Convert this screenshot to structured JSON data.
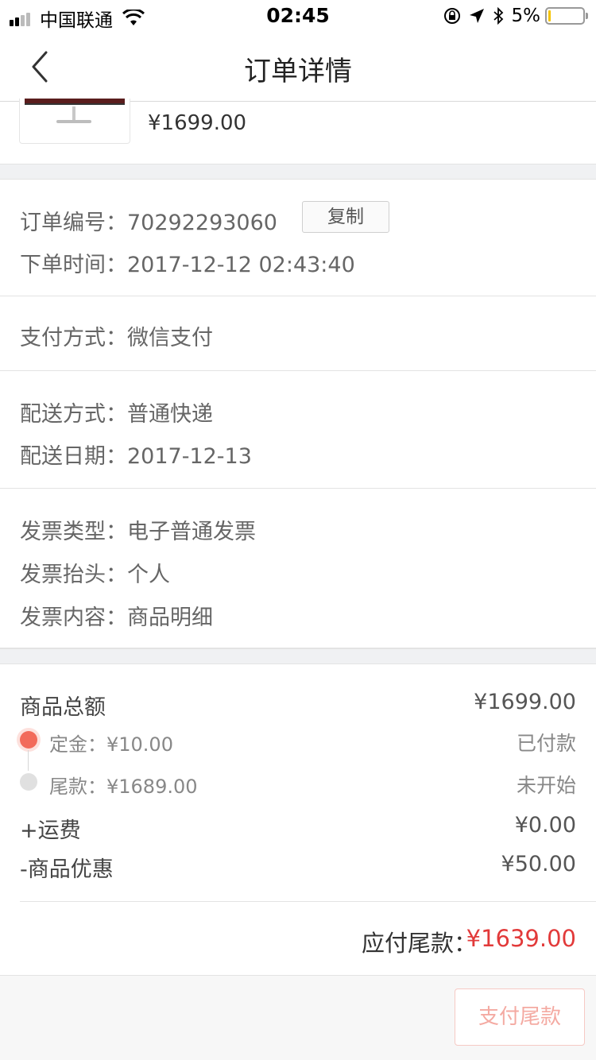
{
  "status_bar": {
    "carrier": "中国联通",
    "time": "02:45",
    "battery": "5%",
    "battery_level": 0.05
  },
  "nav": {
    "title": "订单详情",
    "back_icon": "chevron-left-icon"
  },
  "product": {
    "price": "¥1699.00",
    "thumbnail_icon": "monitor-icon"
  },
  "order_info": {
    "number_label": "订单编号：",
    "number_value": "70292293060",
    "copy_label": "复制",
    "time_label": "下单时间：",
    "time_value": "2017-12-12 02:43:40"
  },
  "payment": {
    "method_label": "支付方式：",
    "method_value": "微信支付"
  },
  "delivery": {
    "method_label": "配送方式：",
    "method_value": "普通快递",
    "date_label": "配送日期：",
    "date_value": "2017-12-13"
  },
  "invoice": {
    "type_label": "发票类型：",
    "type_value": "电子普通发票",
    "title_label": "发票抬头：",
    "title_value": "个人",
    "content_label": "发票内容：",
    "content_value": "商品明细"
  },
  "amounts": {
    "goods_total_label": "商品总额",
    "goods_total_value": "¥1699.00",
    "deposit_label": "定金：¥10.00",
    "deposit_status": "已付款",
    "balance_label": "尾款：¥1689.00",
    "balance_status": "未开始",
    "shipping_label": "+运费",
    "shipping_value": "¥0.00",
    "discount_label": "-商品优惠",
    "discount_value": "¥50.00",
    "due_label": "应付尾款：",
    "due_value": "¥1639.00"
  },
  "bottom": {
    "pay_button": "支付尾款"
  },
  "colors": {
    "accent_red": "#e23a3a",
    "active_dot": "#f26b5b",
    "page_bg": "#f0f1f3"
  }
}
